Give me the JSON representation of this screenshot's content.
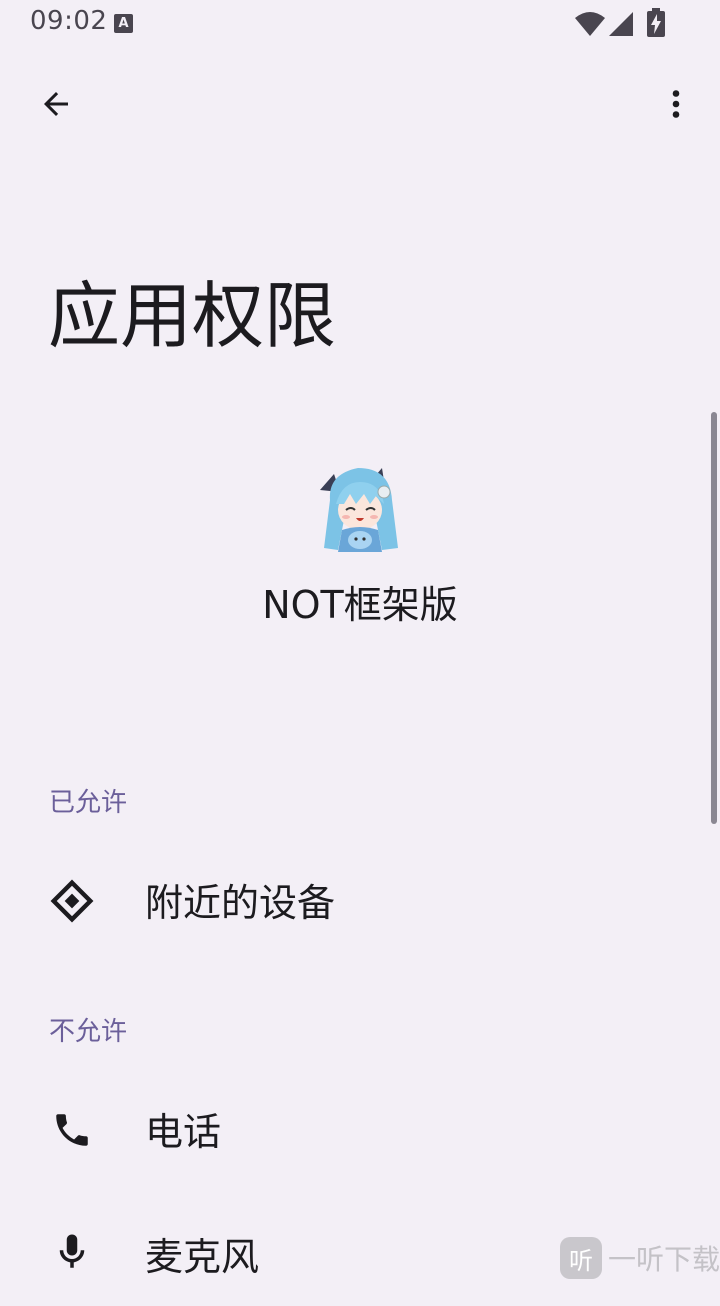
{
  "status_bar": {
    "time": "09:02",
    "notification_icon_letter": "A",
    "icons": [
      "wifi-icon",
      "signal-icon",
      "battery-charging-icon"
    ]
  },
  "app_bar": {
    "back_icon": "arrow-back-icon",
    "more_icon": "more-vert-icon"
  },
  "page": {
    "title": "应用权限"
  },
  "app": {
    "name": "NOT框架版",
    "icon": "anime-girl-app-icon"
  },
  "sections": {
    "allowed": {
      "header": "已允许",
      "items": [
        {
          "label": "附近的设备",
          "icon": "nearby-devices-icon"
        }
      ]
    },
    "denied": {
      "header": "不允许",
      "items": [
        {
          "label": "电话",
          "icon": "phone-icon"
        },
        {
          "label": "麦克风",
          "icon": "microphone-icon"
        }
      ]
    }
  },
  "watermark": {
    "icon_text": "听",
    "text": "一听下载"
  },
  "colors": {
    "background": "#f3eff6",
    "section_header": "#6b5f9a",
    "text_primary": "#1c1b1f"
  }
}
